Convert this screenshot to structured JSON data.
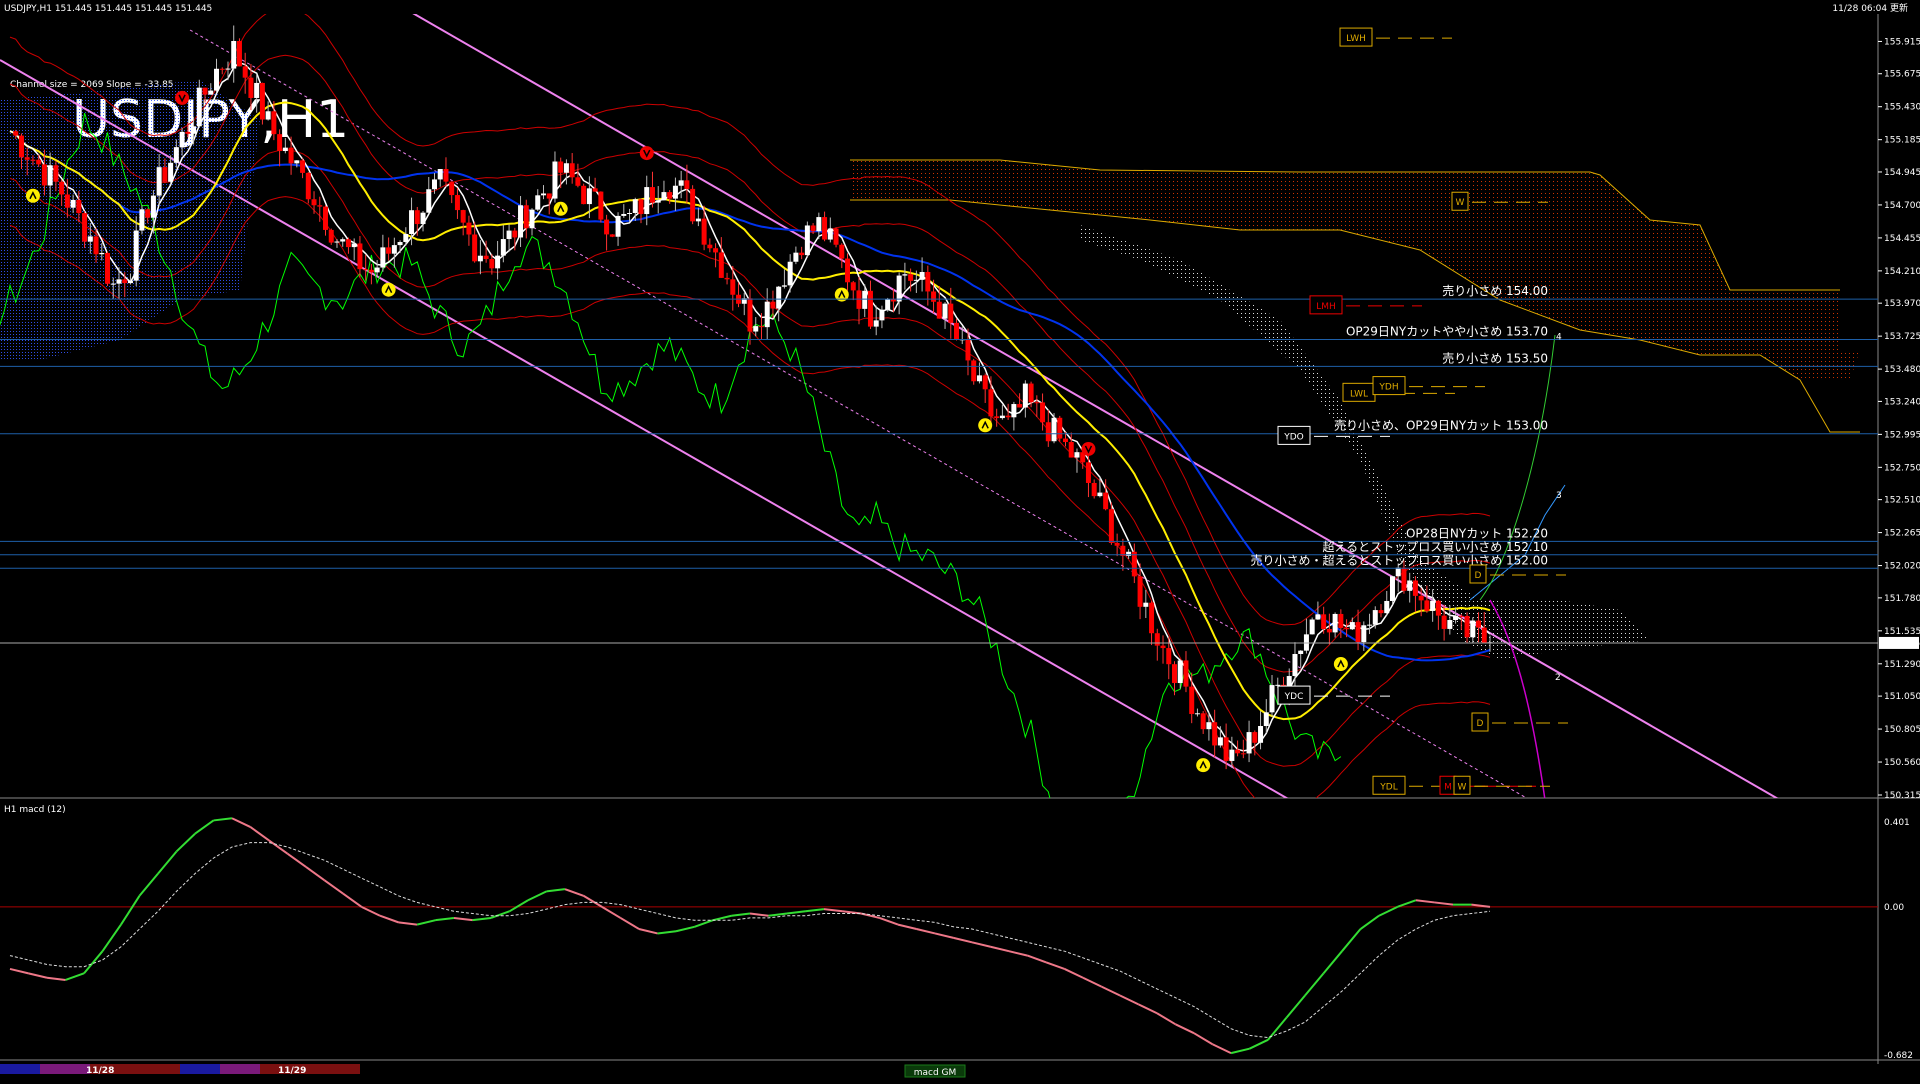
{
  "header": {
    "info": "USDJPY,H1  151.445 151.445 151.445 151.445",
    "datetime": "11/28 06:04 更新",
    "channel_info": "Channel size = 2069 Slope = -33.85",
    "watermark": "USDJPY,H1"
  },
  "macd_panel": {
    "label": "H1  macd (12)",
    "watermark": "macd GM"
  },
  "colors": {
    "background": "#000000",
    "channel": "#ee82ee",
    "ma_fast": "#ffffff",
    "ma_mid": "#ffee00",
    "ma_slow": "#0033ee",
    "chikou": "#00ff00",
    "bollinger": "#cc0000",
    "level_line": "#1e5fa8",
    "macd_main": "#33dd33",
    "macd_neg": "#ee7788",
    "macd_signal": "#dddddd",
    "cloud_top": "#ddaa00",
    "cloud_fill": "#cc3300",
    "up_candle": "#ffffff",
    "down_candle": "#ff0000"
  },
  "chart_data": {
    "type": "candlestick",
    "symbol": "USDJPY",
    "timeframe": "H1",
    "ylim": [
      150.315,
      156.0
    ],
    "y_ticks": [
      155.915,
      155.675,
      155.43,
      155.185,
      154.945,
      154.7,
      154.455,
      154.21,
      153.97,
      153.725,
      153.48,
      153.24,
      152.995,
      152.75,
      152.51,
      152.265,
      152.02,
      151.78,
      151.535,
      151.29,
      151.05,
      150.805,
      150.56,
      150.315
    ],
    "current_price": 151.445,
    "current_price_label": "151.445",
    "close_path": [
      155.25,
      155.1,
      154.95,
      154.8,
      154.6,
      154.4,
      154.1,
      154.25,
      154.7,
      154.95,
      155.2,
      155.45,
      155.7,
      155.85,
      155.6,
      155.3,
      155.1,
      154.9,
      154.7,
      154.45,
      154.3,
      154.2,
      154.35,
      154.55,
      154.7,
      154.85,
      154.6,
      154.4,
      154.3,
      154.45,
      154.65,
      154.8,
      154.95,
      154.85,
      154.7,
      154.55,
      154.6,
      154.75,
      154.9,
      154.8,
      154.6,
      154.35,
      154.1,
      153.85,
      153.95,
      154.2,
      154.45,
      154.55,
      154.35,
      154.1,
      153.9,
      154.05,
      154.2,
      154.1,
      153.95,
      153.7,
      153.4,
      153.15,
      153.05,
      153.25,
      153.1,
      152.95,
      152.8,
      152.55,
      152.3,
      152.0,
      151.7,
      151.4,
      151.2,
      150.95,
      150.75,
      150.55,
      150.7,
      150.95,
      151.2,
      151.45,
      151.7,
      151.6,
      151.5,
      151.65,
      151.85,
      151.95,
      151.8,
      151.65,
      151.55,
      151.5,
      151.45
    ],
    "macd": {
      "label": "macd (12)",
      "ylim": [
        -0.682,
        0.401
      ],
      "tick_labels": [
        "0.401",
        "0.00",
        "-0.682"
      ],
      "main": [
        -0.28,
        -0.3,
        -0.32,
        -0.33,
        -0.3,
        -0.2,
        -0.08,
        0.05,
        0.15,
        0.25,
        0.33,
        0.39,
        0.4,
        0.36,
        0.3,
        0.24,
        0.18,
        0.12,
        0.06,
        0.0,
        -0.04,
        -0.07,
        -0.08,
        -0.06,
        -0.05,
        -0.06,
        -0.05,
        -0.02,
        0.03,
        0.07,
        0.08,
        0.05,
        0.0,
        -0.05,
        -0.1,
        -0.12,
        -0.11,
        -0.09,
        -0.06,
        -0.04,
        -0.03,
        -0.04,
        -0.03,
        -0.02,
        -0.01,
        -0.02,
        -0.03,
        -0.05,
        -0.08,
        -0.1,
        -0.12,
        -0.14,
        -0.16,
        -0.18,
        -0.2,
        -0.22,
        -0.25,
        -0.28,
        -0.32,
        -0.36,
        -0.4,
        -0.44,
        -0.48,
        -0.53,
        -0.57,
        -0.62,
        -0.66,
        -0.64,
        -0.6,
        -0.5,
        -0.4,
        -0.3,
        -0.2,
        -0.1,
        -0.04,
        0.0,
        0.03,
        0.02,
        0.01,
        0.01,
        0.0
      ],
      "signal": [
        -0.22,
        -0.24,
        -0.26,
        -0.27,
        -0.27,
        -0.24,
        -0.18,
        -0.1,
        -0.02,
        0.07,
        0.15,
        0.22,
        0.27,
        0.29,
        0.29,
        0.27,
        0.24,
        0.21,
        0.17,
        0.13,
        0.09,
        0.05,
        0.02,
        0.0,
        -0.02,
        -0.03,
        -0.04,
        -0.04,
        -0.03,
        -0.01,
        0.01,
        0.02,
        0.02,
        0.01,
        -0.01,
        -0.03,
        -0.05,
        -0.06,
        -0.06,
        -0.06,
        -0.05,
        -0.05,
        -0.04,
        -0.04,
        -0.03,
        -0.03,
        -0.03,
        -0.04,
        -0.05,
        -0.06,
        -0.07,
        -0.09,
        -0.1,
        -0.12,
        -0.14,
        -0.16,
        -0.18,
        -0.2,
        -0.23,
        -0.26,
        -0.29,
        -0.33,
        -0.37,
        -0.41,
        -0.45,
        -0.5,
        -0.55,
        -0.58,
        -0.59,
        -0.56,
        -0.52,
        -0.45,
        -0.38,
        -0.3,
        -0.22,
        -0.15,
        -0.1,
        -0.06,
        -0.04,
        -0.03,
        -0.02
      ]
    },
    "levels": [
      {
        "price": 154.0,
        "label": "売り小さめ 154.00"
      },
      {
        "price": 153.7,
        "label": "OP29日NYカットやや小さめ 153.70"
      },
      {
        "price": 153.5,
        "label": "売り小さめ 153.50"
      },
      {
        "price": 153.0,
        "label": "売り小さめ、OP29日NYカット 153.00"
      },
      {
        "price": 152.2,
        "label": "OP28日NYカット 152.20"
      },
      {
        "price": 152.1,
        "label": "超えるとストップロス買い小さめ 152.10"
      },
      {
        "price": 152.0,
        "label": "売り小さめ・超えるとストップロス買い小さめ 152.00"
      }
    ],
    "markers": [
      {
        "price": 155.94,
        "label": "LWH",
        "color": "#ddaa00"
      },
      {
        "price": 154.72,
        "label": "W",
        "color": "#ddaa00"
      },
      {
        "price": 153.95,
        "label": "LMH",
        "color": "#ee0000"
      },
      {
        "price": 153.3,
        "label": "LWL",
        "color": "#ddaa00"
      },
      {
        "price": 153.35,
        "label": "YDH",
        "color": "#ddaa00"
      },
      {
        "price": 152.98,
        "label": "YDO",
        "color": "#ffffff"
      },
      {
        "price": 151.95,
        "label": "D",
        "color": "#ddaa00"
      },
      {
        "price": 151.05,
        "label": "YDC",
        "color": "#ffffff"
      },
      {
        "price": 150.85,
        "label": "D",
        "color": "#ddaa00"
      },
      {
        "price": 150.38,
        "label": "YDL",
        "color": "#ddaa00"
      },
      {
        "price": 150.38,
        "label": "M",
        "color": "#ee0000"
      },
      {
        "price": 150.38,
        "label": "W",
        "color": "#ddaa00"
      }
    ],
    "projections": [
      {
        "label": "4",
        "price": 153.73
      },
      {
        "label": "3",
        "price": 152.55
      },
      {
        "label": "2",
        "price": 151.2
      }
    ],
    "date_labels": [
      "11/28",
      "11/29"
    ]
  }
}
